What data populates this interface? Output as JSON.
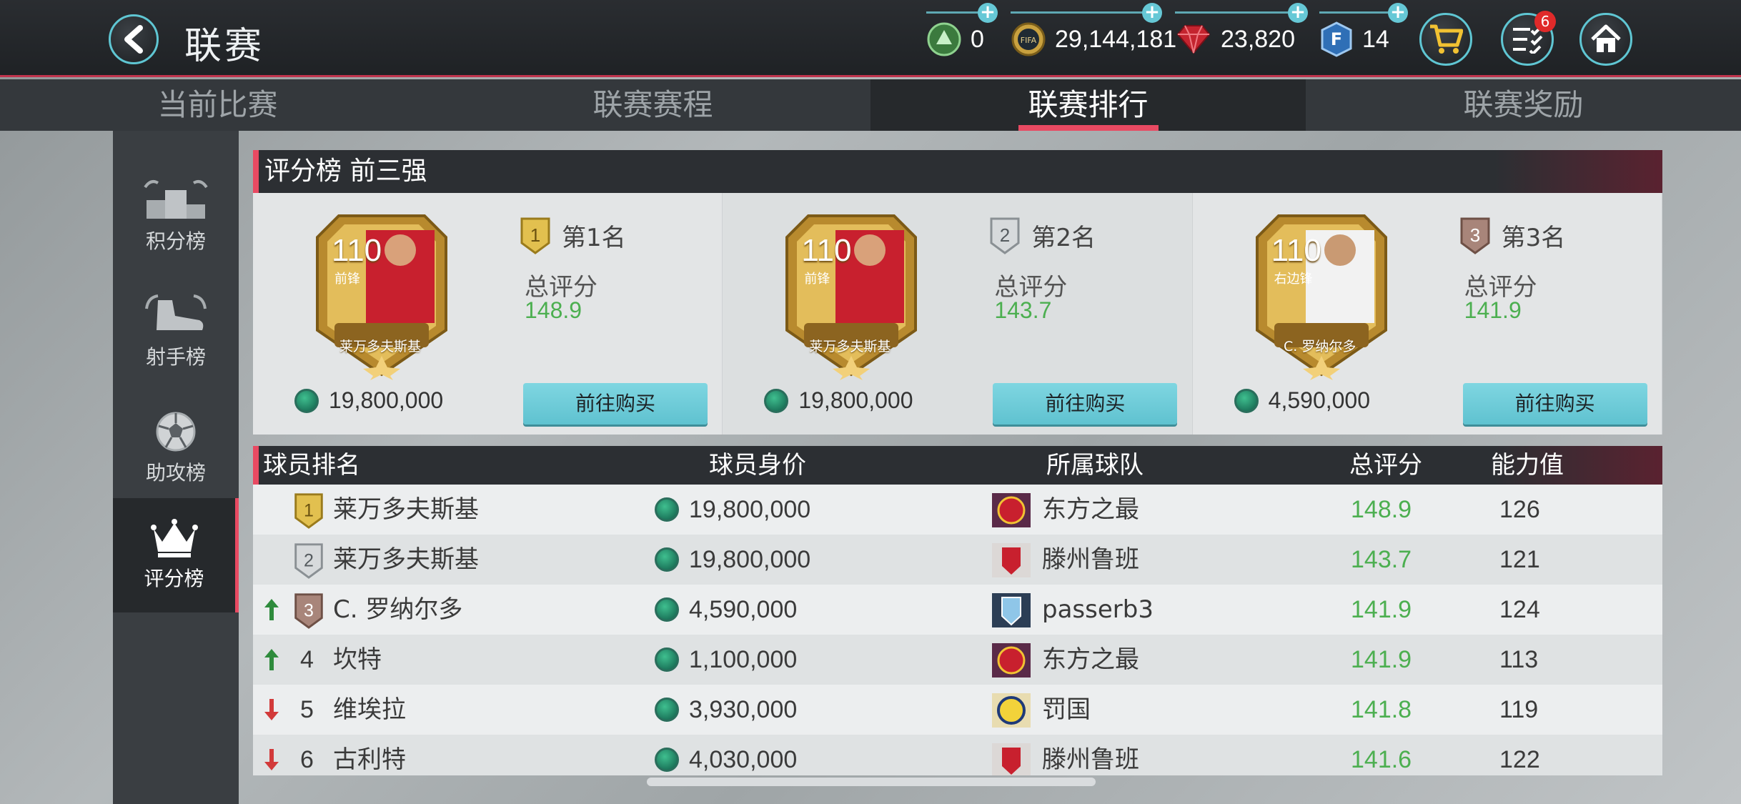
{
  "header": {
    "title": "联赛",
    "currencies": [
      {
        "name": "green-token",
        "value": "0"
      },
      {
        "name": "coins",
        "value": "29,144,181"
      },
      {
        "name": "gems",
        "value": "23,820"
      },
      {
        "name": "fifa-points",
        "value": "14"
      }
    ],
    "notification_count": "6"
  },
  "tabs": [
    "当前比赛",
    "联赛赛程",
    "联赛排行",
    "联赛奖励"
  ],
  "active_tab": "联赛排行",
  "sidebar": [
    {
      "label": "积分榜",
      "icon": "podium-icon"
    },
    {
      "label": "射手榜",
      "icon": "boot-icon"
    },
    {
      "label": "助攻榜",
      "icon": "ball-icon"
    },
    {
      "label": "评分榜",
      "icon": "crown-icon"
    }
  ],
  "active_sidebar": "评分榜",
  "top3": {
    "title": "评分榜 前三强",
    "score_label": "总评分",
    "buy_label": "前往购买",
    "cards": [
      {
        "rank": "1",
        "rank_text": "第1名",
        "rating": "110",
        "position": "前锋",
        "name": "莱万多夫斯基",
        "score": "148.9",
        "price": "19,800,000"
      },
      {
        "rank": "2",
        "rank_text": "第2名",
        "rating": "110",
        "position": "前锋",
        "name": "莱万多夫斯基",
        "score": "143.7",
        "price": "19,800,000"
      },
      {
        "rank": "3",
        "rank_text": "第3名",
        "rating": "110",
        "position": "右边锋",
        "name": "C. 罗纳尔多",
        "score": "141.9",
        "price": "4,590,000"
      }
    ]
  },
  "table": {
    "headers": [
      "球员排名",
      "球员身价",
      "所属球队",
      "总评分",
      "能力值"
    ],
    "rows": [
      {
        "rank": "1",
        "trend": "none",
        "name": "莱万多夫斯基",
        "price": "19,800,000",
        "team": "东方之最",
        "score": "148.9",
        "ability": "126"
      },
      {
        "rank": "2",
        "trend": "none",
        "name": "莱万多夫斯基",
        "price": "19,800,000",
        "team": "滕州鲁班",
        "score": "143.7",
        "ability": "121"
      },
      {
        "rank": "3",
        "trend": "up",
        "name": "C. 罗纳尔多",
        "price": "4,590,000",
        "team": "passerb3",
        "score": "141.9",
        "ability": "124"
      },
      {
        "rank": "4",
        "trend": "up",
        "name": "坎特",
        "price": "1,100,000",
        "team": "东方之最",
        "score": "141.9",
        "ability": "113"
      },
      {
        "rank": "5",
        "trend": "down",
        "name": "维埃拉",
        "price": "3,930,000",
        "team": "罚国",
        "score": "141.8",
        "ability": "119"
      },
      {
        "rank": "6",
        "trend": "down",
        "name": "古利特",
        "price": "4,030,000",
        "team": "滕州鲁班",
        "score": "141.6",
        "ability": "122"
      }
    ]
  },
  "colors": {
    "accent": "#e84a62",
    "teal": "#5fc6d3",
    "score_green": "#4caf50",
    "trend_up": "#2e8b3c",
    "trend_down": "#d23a3a"
  }
}
